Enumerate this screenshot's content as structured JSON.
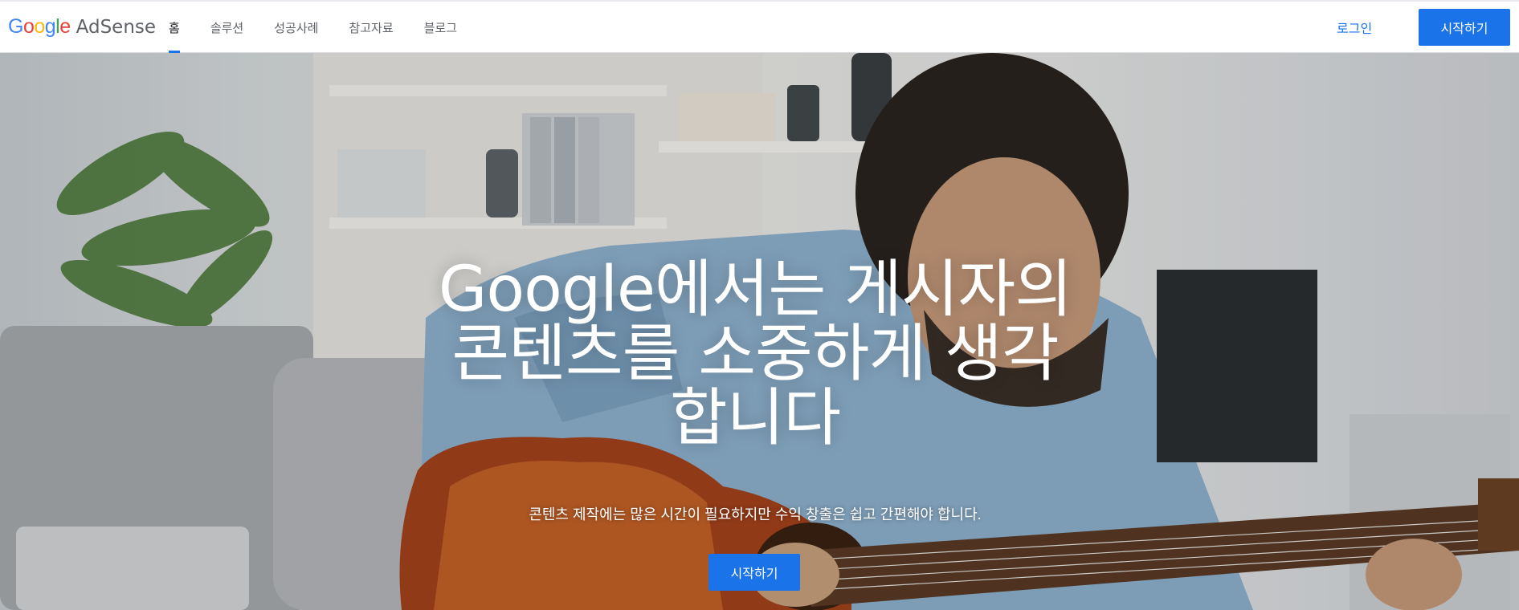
{
  "header": {
    "logo": {
      "google_letters": [
        {
          "char": "G",
          "color": "#4285F4"
        },
        {
          "char": "o",
          "color": "#EA4335"
        },
        {
          "char": "o",
          "color": "#FBBC05"
        },
        {
          "char": "g",
          "color": "#4285F4"
        },
        {
          "char": "l",
          "color": "#34A853"
        },
        {
          "char": "e",
          "color": "#EA4335"
        }
      ],
      "product": "AdSense"
    },
    "nav": [
      {
        "label": "홈",
        "active": true
      },
      {
        "label": "솔루션",
        "active": false
      },
      {
        "label": "성공사례",
        "active": false
      },
      {
        "label": "참고자료",
        "active": false
      },
      {
        "label": "블로그",
        "active": false
      }
    ],
    "login_label": "로그인",
    "start_label": "시작하기"
  },
  "hero": {
    "headline": "Google에서는 게시자의 콘텐츠를 소중하게 생각합니다",
    "subline": "콘텐츠 제작에는 많은 시간이 필요하지만 수익 창출은 쉽고 간편해야 합니다.",
    "cta_label": "시작하기"
  },
  "colors": {
    "accent": "#1a73e8",
    "active_underline": "#1a73e8",
    "nav_text": "#5f6368"
  }
}
